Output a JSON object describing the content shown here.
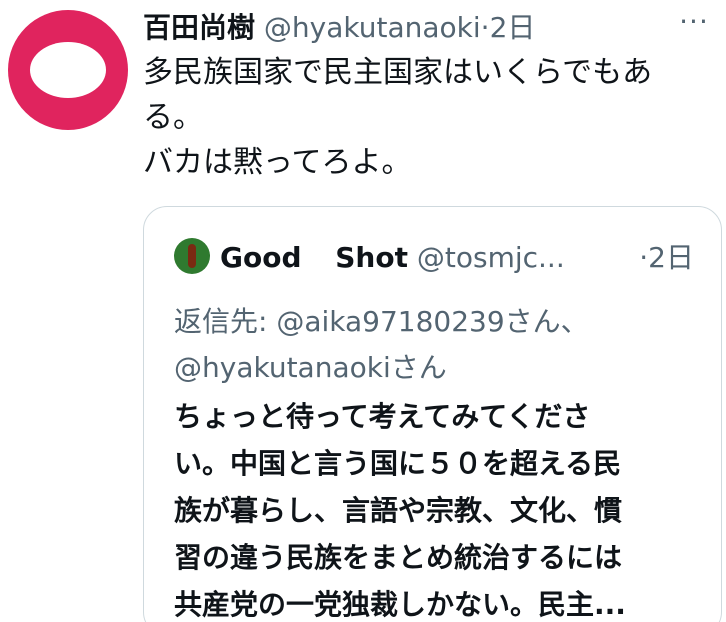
{
  "tweet": {
    "display_name": "百田尚樹",
    "handle": "@hyakutanaoki",
    "separator": "·",
    "time": "2日",
    "more_label": "···",
    "text_lines": [
      "多民族国家で民主国家はいくらでもあ",
      "る。",
      "バカは黙ってろよ。"
    ]
  },
  "quote": {
    "display_name": "Good Shot",
    "handle": "@tosmjc...",
    "separator": "·",
    "time": "2日",
    "reply_prefix": "返信先:",
    "reply_user_1": "@aika97180239さん、",
    "reply_user_2": "@hyakutanaokiさん",
    "text_lines": [
      "ちょっと待って考えてみてくださ",
      "い。中国と言う国に５０を超える民",
      "族が暮らし、言語や宗教、文化、慣",
      "習の違う民族をまとめ統治するには",
      "共産党の一党独裁しかない。民主..."
    ]
  },
  "colors": {
    "avatar_bg": "#e0245e",
    "secondary_text": "#536471",
    "primary_text": "#0f1419",
    "quote_border": "#cfd9de"
  }
}
